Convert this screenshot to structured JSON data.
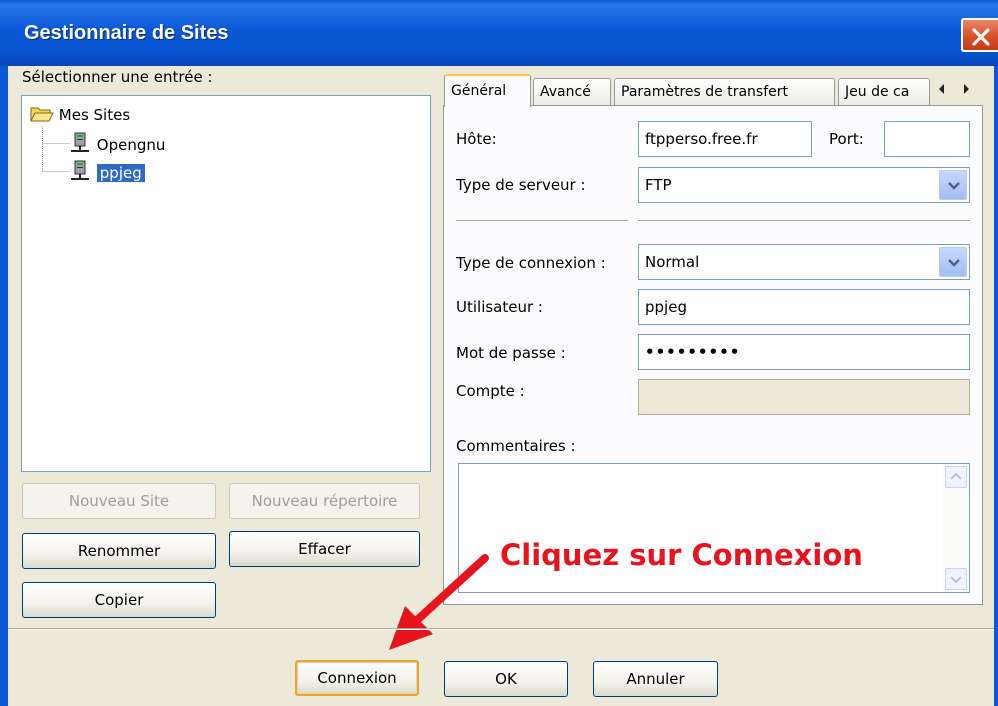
{
  "window": {
    "title": "Gestionnaire de Sites"
  },
  "sites_panel": {
    "label": "Sélectionner une entrée :",
    "tree": {
      "root": "Mes Sites",
      "children": [
        "Opengnu",
        "ppjeg"
      ],
      "selected": "ppjeg"
    },
    "buttons": {
      "new_site": "Nouveau Site",
      "new_folder": "Nouveau répertoire",
      "rename": "Renommer",
      "delete": "Effacer",
      "copy": "Copier"
    }
  },
  "tabs": [
    {
      "label": "Général",
      "active": true
    },
    {
      "label": "Avancé",
      "active": false
    },
    {
      "label": "Paramètres de transfert",
      "active": false
    },
    {
      "label": "Jeu de ca",
      "active": false
    }
  ],
  "general": {
    "host_label": "Hôte:",
    "host_value": "ftpperso.free.fr",
    "port_label": "Port:",
    "port_value": "",
    "server_type_label": "Type de serveur :",
    "server_type_value": "FTP",
    "connection_type_label": "Type de connexion :",
    "connection_type_value": "Normal",
    "user_label": "Utilisateur :",
    "user_value": "ppjeg",
    "password_label": "Mot de passe :",
    "password_value": "•••••••••",
    "account_label": "Compte :",
    "account_value": "",
    "comments_label": "Commentaires :",
    "comments_value": ""
  },
  "annotation": {
    "text": "Cliquez sur Connexion",
    "color": "#e8141d"
  },
  "footer": {
    "connect": "Connexion",
    "ok": "OK",
    "cancel": "Annuler"
  },
  "colors": {
    "titlebar": "#0a58d6",
    "selection": "#316ac5",
    "close_button": "#d8542e"
  }
}
